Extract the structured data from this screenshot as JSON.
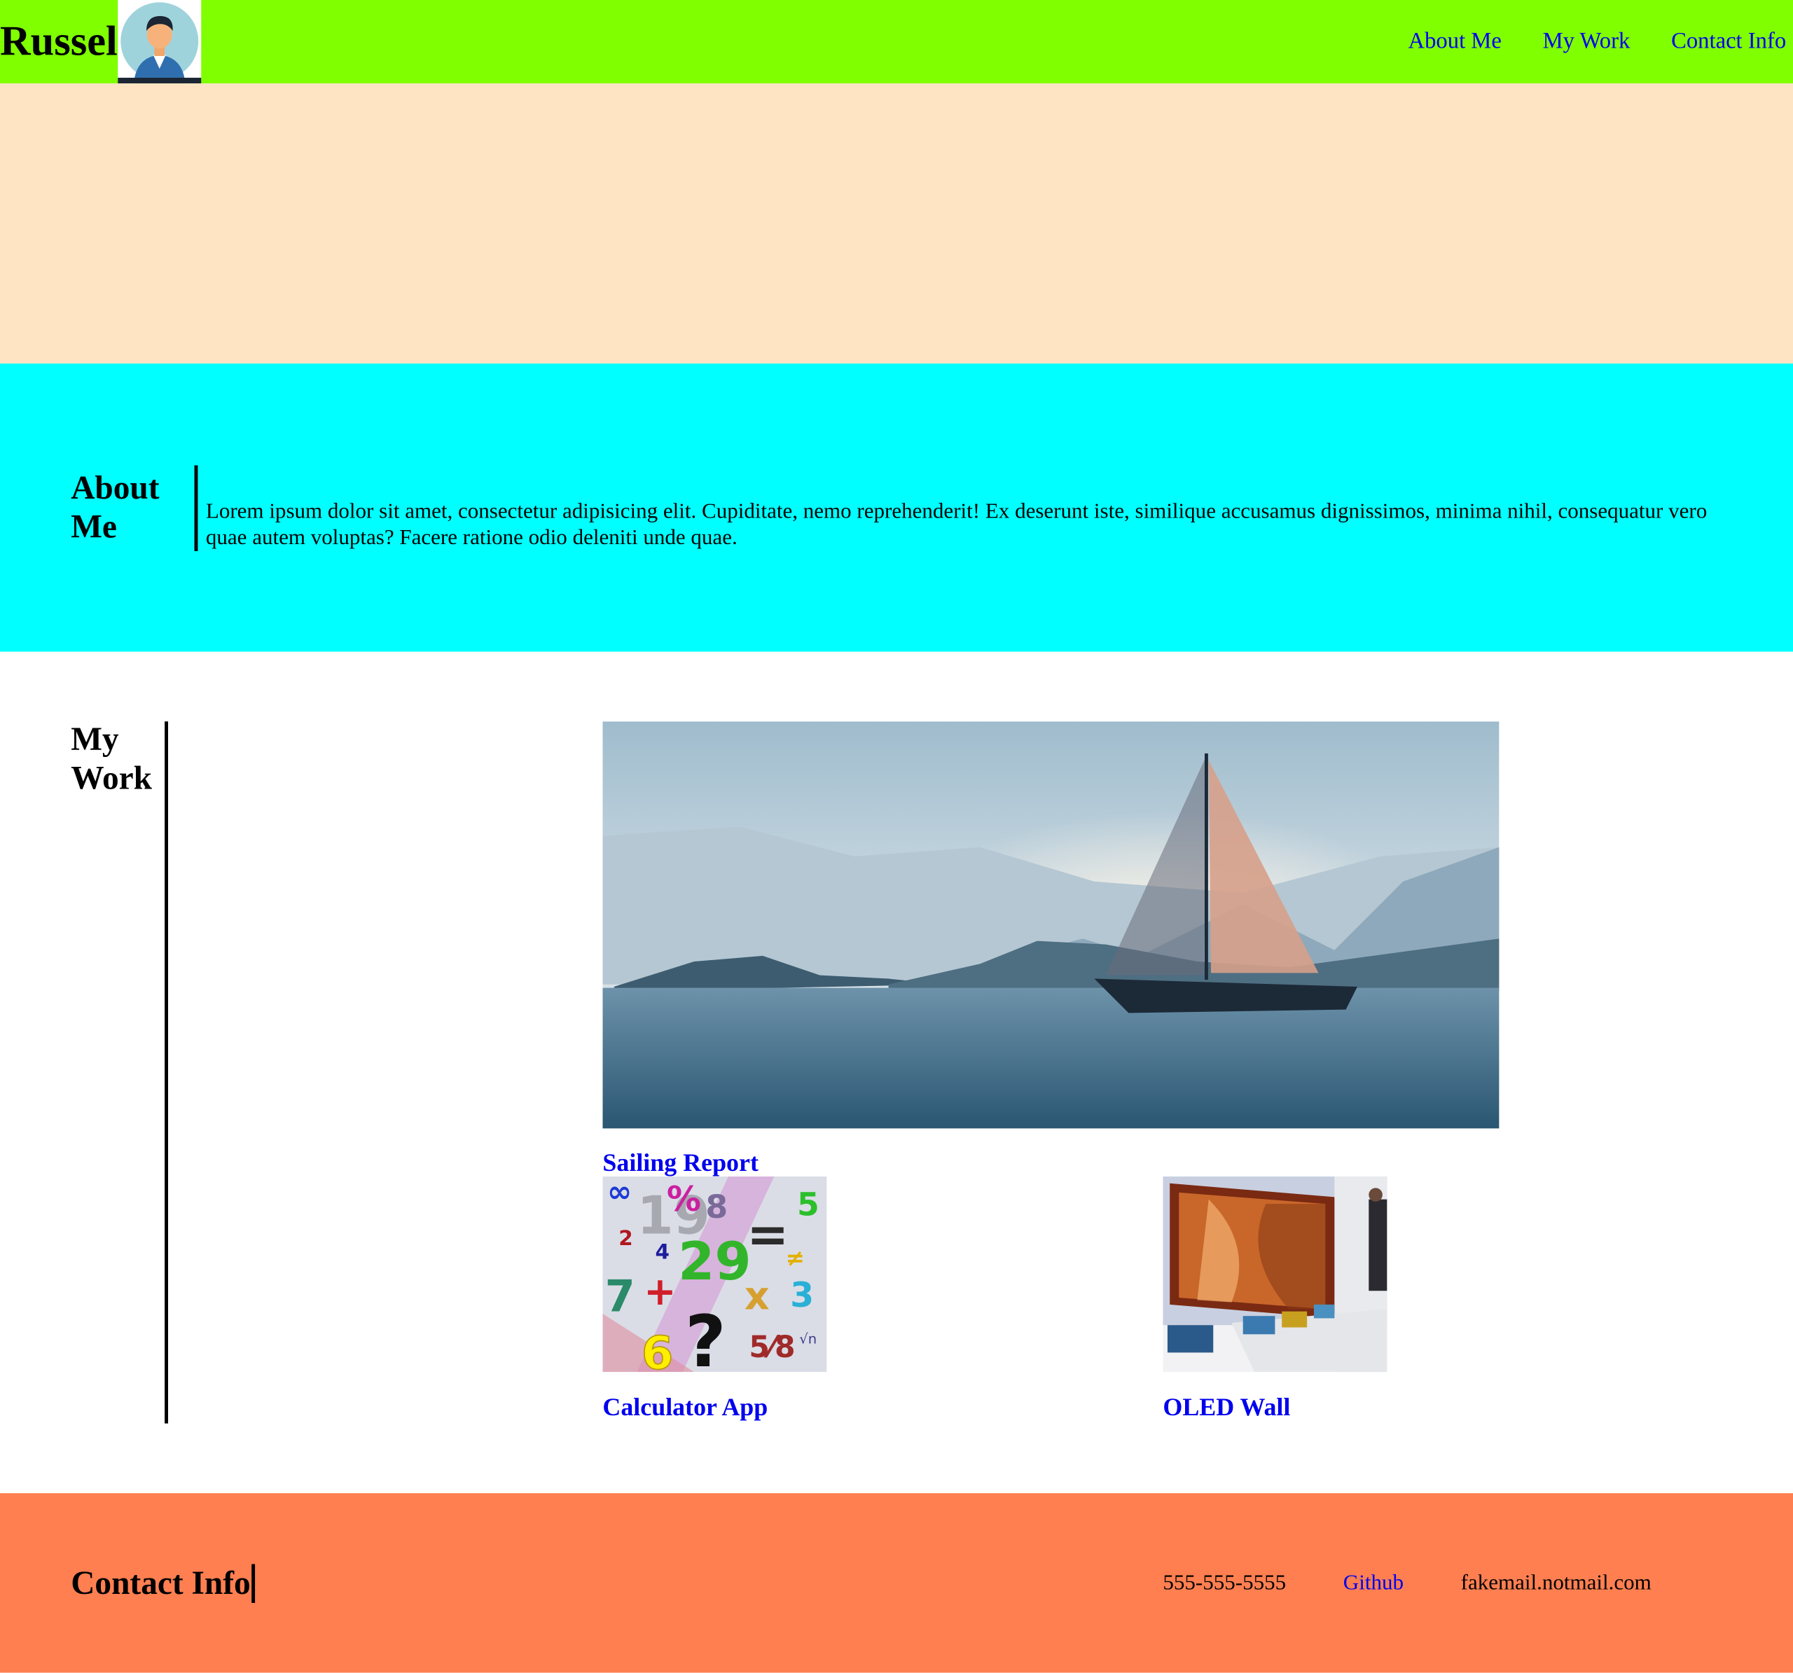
{
  "header": {
    "brand": "Russel",
    "nav": [
      "About Me",
      "My Work",
      "Contact Info"
    ]
  },
  "about": {
    "title": "About Me",
    "text": "Lorem ipsum dolor sit amet, consectetur adipisicing elit. Cupiditate, nemo reprehenderit! Ex deserunt iste, similique accusamus dignissimos, minima nihil, consequatur vero quae autem voluptas? Facere ratione odio deleniti unde quae."
  },
  "work": {
    "title": "My Work",
    "projects": [
      "Sailing Report",
      "Calculator App",
      "OLED Wall"
    ]
  },
  "contact": {
    "title": "Contact Info",
    "phone": "555-555-5555",
    "github": "Github",
    "email": "fakemail.notmail.com"
  },
  "colors": {
    "header": "#7fff00",
    "hero": "#ffe4c4",
    "about": "#00ffff",
    "footer": "#ff7f50",
    "link": "#0000ee"
  }
}
